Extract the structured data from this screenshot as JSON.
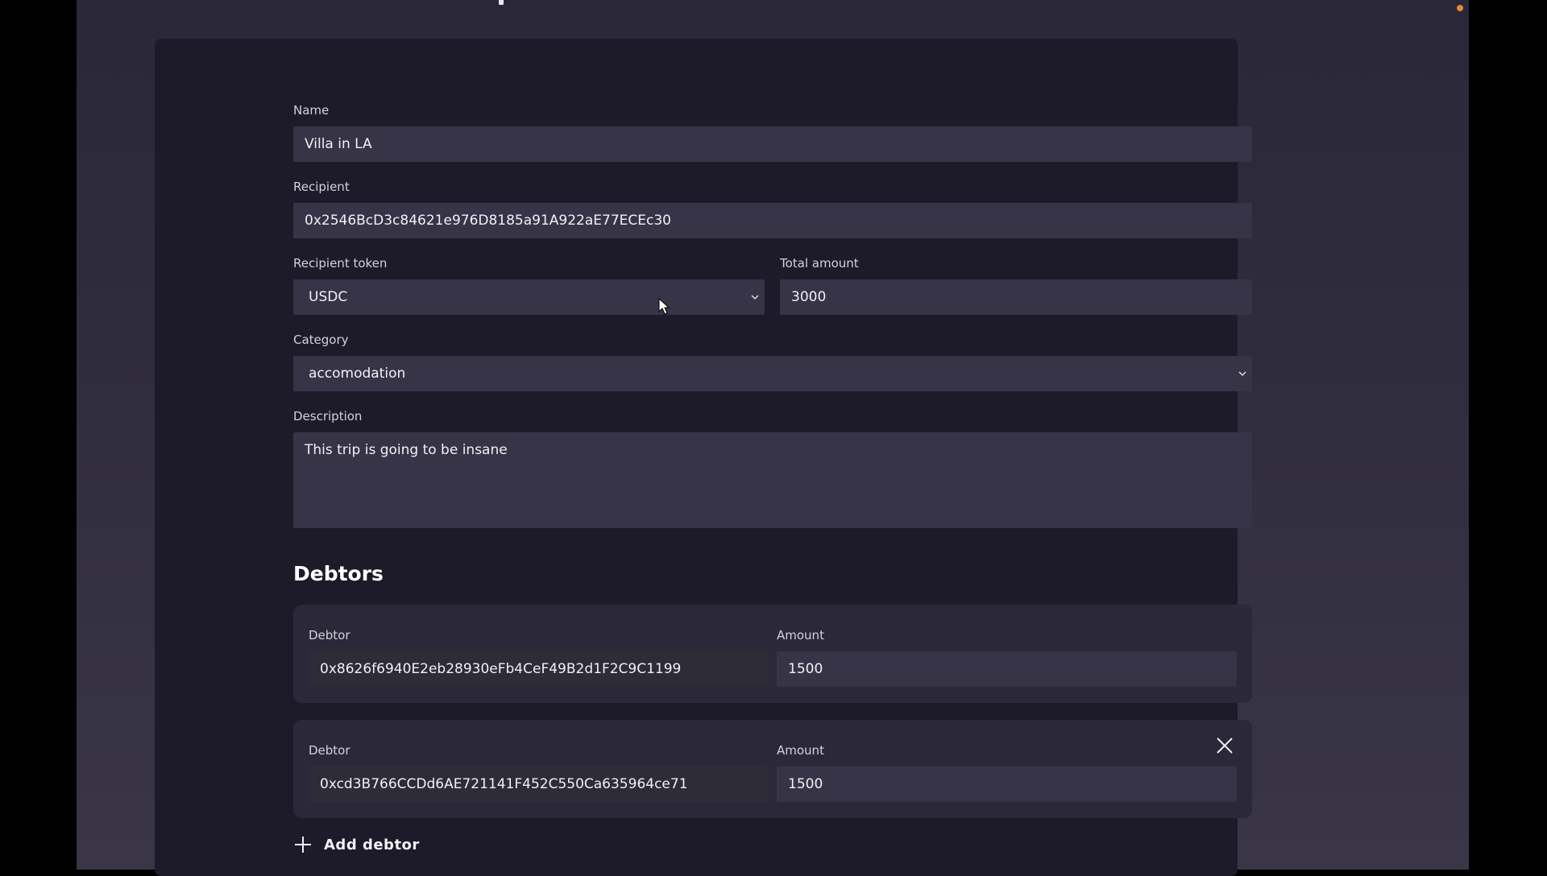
{
  "form": {
    "name_label": "Name",
    "name_value": "Villa in LA",
    "recipient_label": "Recipient",
    "recipient_value": "0x2546BcD3c84621e976D8185a91A922aE77ECEc30",
    "recipient_token_label": "Recipient token",
    "recipient_token_value": "USDC",
    "total_amount_label": "Total amount",
    "total_amount_value": "3000",
    "category_label": "Category",
    "category_value": "accomodation",
    "description_label": "Description",
    "description_value": "This trip is going to be insane"
  },
  "debtors": {
    "title": "Debtors",
    "items": [
      {
        "debtor_label": "Debtor",
        "debtor_value": "0x8626f6940E2eb28930eFb4CeF49B2d1F2C9C1199",
        "amount_label": "Amount",
        "amount_value": "1500"
      },
      {
        "debtor_label": "Debtor",
        "debtor_value": "0xcd3B766CCDd6AE721141F452C550Ca635964ce71",
        "amount_label": "Amount",
        "amount_value": "1500"
      }
    ],
    "add_label": "Add debtor"
  },
  "icons": {
    "chevron": "chevron-down-icon",
    "close": "close-icon",
    "add": "plus-icon",
    "cursor": "mouse-cursor-icon"
  },
  "colors": {
    "page_bg": "#2f2c3e",
    "card_bg": "#1d1b29",
    "field_bg": "#373447",
    "accent_dot": "#e38a2e"
  }
}
